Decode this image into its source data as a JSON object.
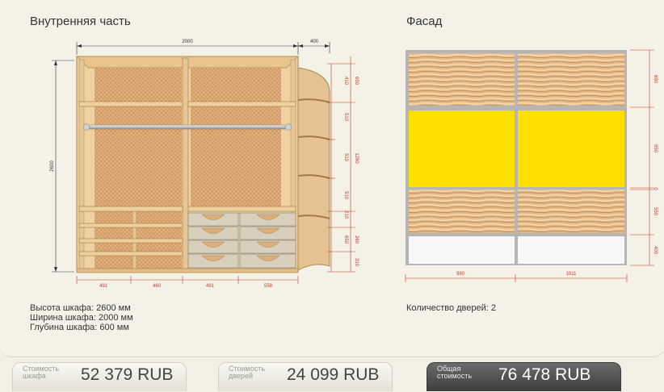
{
  "interior": {
    "title": "Внутренняя часть",
    "dimensions": {
      "width": "2000",
      "side_depth": "400",
      "height": "2600",
      "right": [
        "650",
        "410",
        "510",
        "510",
        "510",
        "1280",
        "210",
        "260",
        "650",
        "310"
      ],
      "bottom": [
        "491",
        "460",
        "491",
        "558"
      ]
    },
    "info": [
      "Высота шкафа: 2600 мм",
      "Ширина шкафа: 2000 мм",
      "Глубина шкафа: 600 мм"
    ]
  },
  "facade": {
    "title": "Фасад",
    "dimensions": {
      "right": [
        "690",
        "950",
        "0",
        "550",
        "400"
      ],
      "bottom": [
        "980",
        "1011"
      ]
    },
    "info": [
      "Количество дверей: 2"
    ],
    "colors": {
      "wood": "#e3b784",
      "yellow": "#ffe000",
      "white": "#f7f7f7",
      "frame": "#b5b5b5"
    }
  },
  "prices": {
    "cabinet": {
      "label": "Стоимость шкафа",
      "value": "52 379  RUB"
    },
    "doors": {
      "label": "Стоимость дверей",
      "value": "24 099  RUB"
    },
    "total": {
      "label": "Общая стоимость",
      "value": "76 478  RUB"
    }
  }
}
